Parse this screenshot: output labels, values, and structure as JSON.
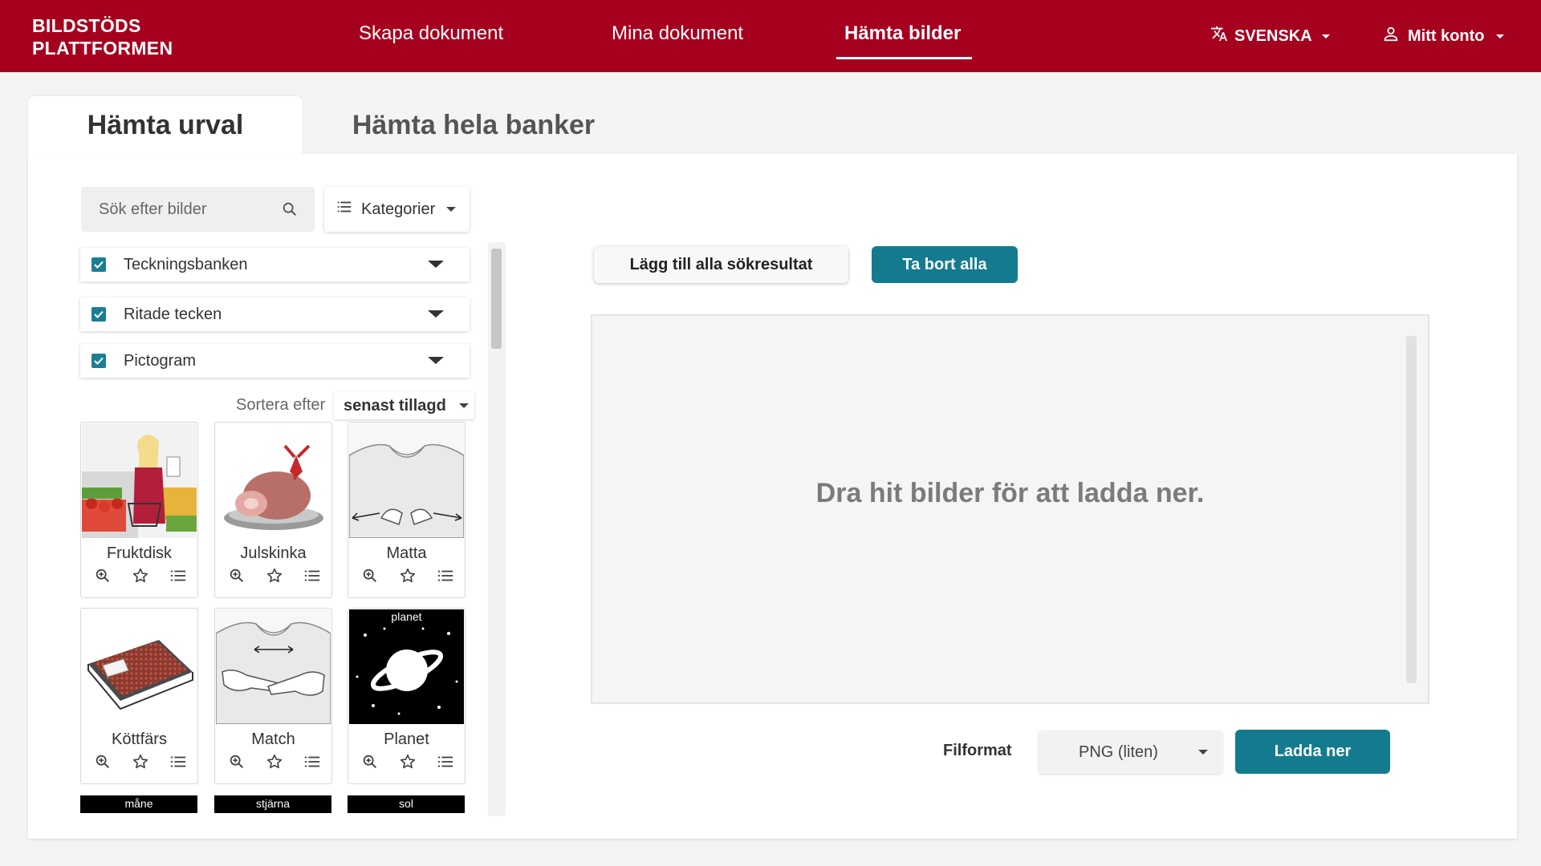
{
  "header": {
    "logo_line1": "BILDSTÖDS",
    "logo_line2": "PLATTFORMEN",
    "nav": [
      "Skapa dokument",
      "Mina dokument",
      "Hämta bilder"
    ],
    "active_nav": "Hämta bilder",
    "language": "SVENSKA",
    "account": "Mitt konto",
    "brand_color": "#a6001f"
  },
  "tabs": [
    "Hämta urval",
    "Hämta hela banker"
  ],
  "search": {
    "placeholder": "Sök efter bilder"
  },
  "categories_label": "Kategorier",
  "banks": [
    {
      "label": "Teckningsbanken",
      "checked": true
    },
    {
      "label": "Ritade tecken",
      "checked": true
    },
    {
      "label": "Pictogram",
      "checked": true
    }
  ],
  "sort": {
    "label": "Sortera efter",
    "value": "senast tillagd"
  },
  "images": [
    {
      "label": "Fruktdisk"
    },
    {
      "label": "Julskinka"
    },
    {
      "label": "Matta"
    },
    {
      "label": "Köttfärs"
    },
    {
      "label": "Match"
    },
    {
      "label": "Planet",
      "caption": "planet"
    }
  ],
  "partial_images": [
    "måne",
    "stjärna",
    "sol"
  ],
  "actions": {
    "add_all": "Lägg till alla sökresultat",
    "remove_all": "Ta bort alla"
  },
  "dropzone_text": "Dra hit bilder för att ladda ner.",
  "file_format": {
    "label": "Filformat",
    "value": "PNG (liten)"
  },
  "download_label": "Ladda ner",
  "accent_color": "#147b8f"
}
